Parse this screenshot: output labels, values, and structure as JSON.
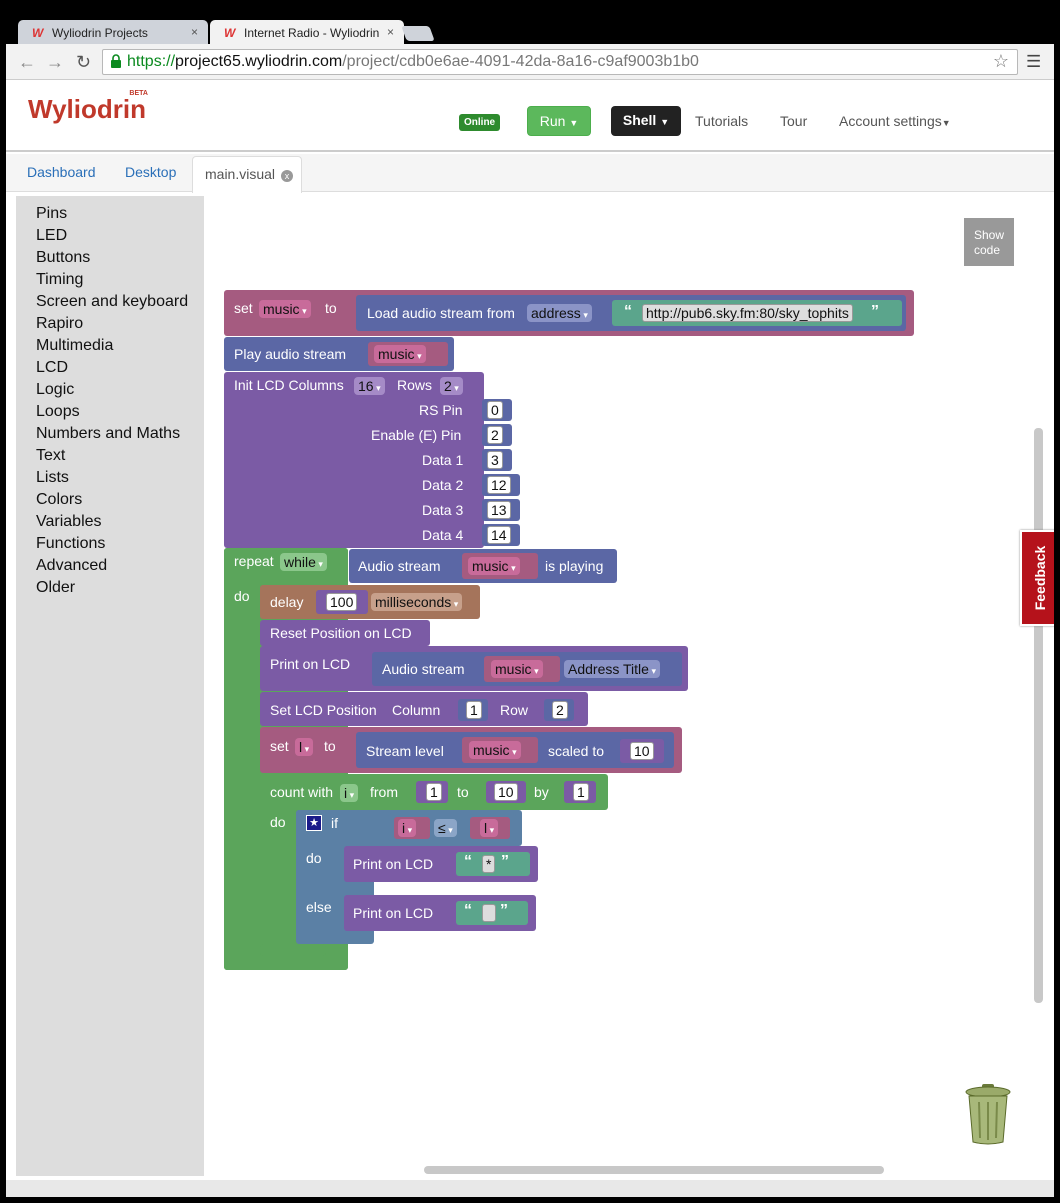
{
  "browser": {
    "tabs": [
      {
        "title": "Wyliodrin Projects",
        "close": "×"
      },
      {
        "title": "Internet Radio - Wyliodrin",
        "close": "×"
      }
    ],
    "url_scheme": "https://",
    "url_host": "project65.wyliodrin.com",
    "url_path": "/project/cdb0e6ae-4091-42da-8a16-c9af9003b1b0"
  },
  "header": {
    "logo": "Wyliodrin",
    "logo_badge": "BETA",
    "status": "Online",
    "run_label": "Run",
    "shell_label": "Shell",
    "tutorials": "Tutorials",
    "tour": "Tour",
    "account": "Account settings"
  },
  "project_tabs": {
    "dashboard": "Dashboard",
    "desktop": "Desktop",
    "file": "main.visual",
    "close": "x"
  },
  "toolbox": [
    "Pins",
    "LED",
    "Buttons",
    "Timing",
    "Screen and keyboard",
    "Rapiro",
    "Multimedia",
    "LCD",
    "Logic",
    "Loops",
    "Numbers and Maths",
    "Text",
    "Lists",
    "Colors",
    "Variables",
    "Functions",
    "Advanced",
    "Older"
  ],
  "show_code": [
    "Show",
    "code"
  ],
  "feedback": "Feedback",
  "blocks": {
    "set": "set",
    "to": "to",
    "var_music": "music",
    "load_stream": "Load audio stream from",
    "address": "address",
    "url": "http://pub6.sky.fm:80/sky_tophits",
    "play_stream": "Play audio stream",
    "init_lcd": "Init LCD Columns",
    "cols": "16",
    "rows_label": "Rows",
    "rows": "2",
    "rs_pin": "RS Pin",
    "rs_val": "0",
    "enable_pin": "Enable (E) Pin",
    "enable_val": "2",
    "data1": "Data 1",
    "data1_val": "3",
    "data2": "Data 2",
    "data2_val": "12",
    "data3": "Data 3",
    "data3_val": "13",
    "data4": "Data 4",
    "data4_val": "14",
    "repeat": "repeat",
    "while": "while",
    "audio_stream": "Audio stream",
    "is_playing": "is playing",
    "do": "do",
    "delay": "delay",
    "delay_val": "100",
    "milliseconds": "milliseconds",
    "reset_pos": "Reset Position on LCD",
    "print_lcd": "Print on LCD",
    "address_title": "Address Title",
    "set_lcd_pos": "Set LCD Position",
    "column": "Column",
    "col_val": "1",
    "row": "Row",
    "row_val": "2",
    "var_l": "l",
    "stream_level": "Stream level",
    "scaled_to": "scaled to",
    "scale_val": "10",
    "count_with": "count with",
    "var_i": "i",
    "from": "from",
    "from_val": "1",
    "to_val": "10",
    "by": "by",
    "by_val": "1",
    "if": "if",
    "leq": "≤",
    "else": "else",
    "star_text": "*",
    "blank_text": " ",
    "open_quote": "“",
    "close_quote": "”"
  },
  "colors": {
    "variables": "#a55b80",
    "multimedia": "#5b67a5",
    "lcd": "#7b5ba5",
    "loops": "#5ba55b",
    "timing": "#a5745b",
    "text": "#5ba58c",
    "logic": "#5b80a5",
    "var_dd": "#c86b9a"
  }
}
